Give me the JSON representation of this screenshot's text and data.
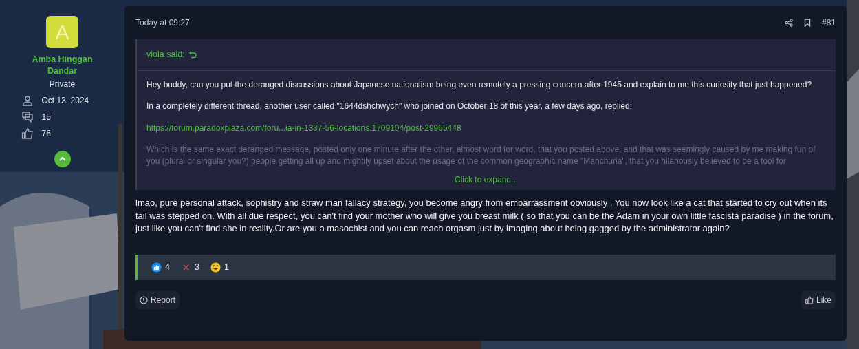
{
  "author": {
    "avatar_letter": "A",
    "name": "Amba Hinggan Dandar",
    "title": "Private",
    "stats": [
      {
        "kind": "joined",
        "value": "Oct 13, 2024"
      },
      {
        "kind": "messages",
        "value": "15"
      },
      {
        "kind": "reactions",
        "value": "76"
      }
    ]
  },
  "post": {
    "time": "Today at 09:27",
    "number": "#81",
    "quote": {
      "attribution": "viola said:",
      "paragraphs": [
        {
          "kind": "text",
          "text": "Hey buddy, can you put the deranged discussions about Japanese nationalism being even remotely a pressing concern after 1945 and explain to me this curiosity that just happened?"
        },
        {
          "kind": "text",
          "text": "In a completely different thread, another user called \"1644dshchwych\" who joined on October 18 of this year, a few days ago, replied:"
        },
        {
          "kind": "link",
          "text": "https://forum.paradoxplaza.com/foru...ia-in-1337-56-locations.1709104/post-29965448"
        },
        {
          "kind": "faded",
          "text": "Which is the same exact deranged message, posted only one minute after the other, almost word for word, that you posted above, and that was seemingly caused by me making fun of you (plural or singular you?) people getting all up and mightily upset about the usage of the common geographic name \"Manchuria\", that you hilariously believed to be a tool for"
        }
      ],
      "expand": "Click to expand..."
    },
    "body": "lmao, pure personal attack, sophistry and straw man fallacy strategy, you become angry from embarrassment obviously . You now look like a cat that started to cry out when its tail was stepped on. With all due respect, you can't find your mother who will give you breast milk ( so that you can be the Adam in your own little fascista paradise ) in the forum, just like you can't find she in reality.Or are you a masochist and you can reach orgasm just by imaging about being gagged by the administrator again?",
    "reactions": [
      {
        "kind": "like",
        "count": "4"
      },
      {
        "kind": "disagree",
        "count": "3"
      },
      {
        "kind": "haha",
        "count": "1"
      }
    ],
    "actions": [
      {
        "kind": "report",
        "label": "Report"
      },
      {
        "kind": "like",
        "label": "Like"
      }
    ]
  }
}
